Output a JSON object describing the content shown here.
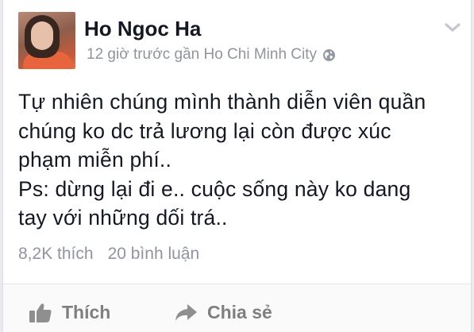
{
  "post": {
    "author": "Ho Ngoc Ha",
    "meta": "12 giờ trước gần Ho Chi Minh City",
    "text_lines": [
      "Tự nhiên chúng mình thành diễn viên quần",
      "chúng ko dc trả lương lại còn được xúc",
      "phạm miễn phí..",
      "Ps: dừng lại đi e.. cuộc sống này ko dang",
      "tay với những dối trá.."
    ],
    "likes": "8,2K thích",
    "comments": "20 bình luận"
  },
  "actions": {
    "like_label": "Thích",
    "share_label": "Chia sẻ"
  },
  "icons": {
    "privacy": "globe-icon",
    "menu": "chevron-down-icon",
    "like": "thumbs-up-icon",
    "share": "share-arrow-icon"
  }
}
